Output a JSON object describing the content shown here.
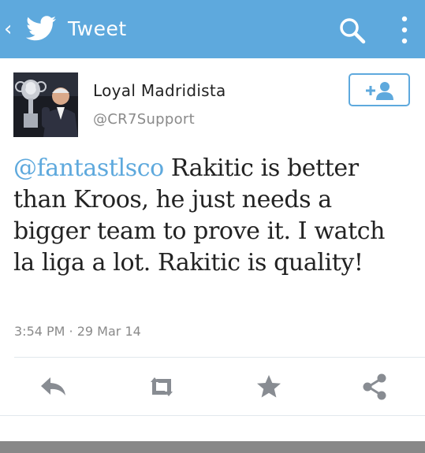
{
  "appbar": {
    "title": "Tweet",
    "back_icon": "chevron-left-icon",
    "logo_icon": "twitter-bird-icon",
    "search_icon": "search-icon",
    "overflow_icon": "overflow-menu-icon",
    "background_color": "#5ea9dd"
  },
  "tweet": {
    "author": {
      "display_name": "Loyal Madridista",
      "handle": "@CR7Support",
      "avatar_icon": "avatar-photo"
    },
    "follow_button_icon": "add-user-icon",
    "mention": "@fantastlsco",
    "text": " Rakitic is better than Kroos, he just needs a bigger team to prove it. I watch la liga a lot. Rakitic is quality!",
    "timestamp": "3:54 PM · 29 Mar 14",
    "accent_color": "#5ea9dd"
  },
  "actions": [
    {
      "icon": "reply-icon"
    },
    {
      "icon": "retweet-icon"
    },
    {
      "icon": "favorite-star-icon"
    },
    {
      "icon": "share-icon"
    }
  ]
}
